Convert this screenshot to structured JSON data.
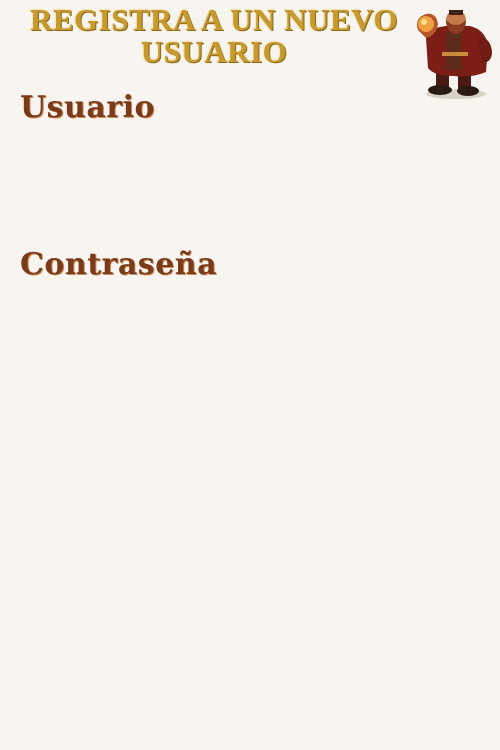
{
  "header": {
    "title": "REGISTRA A UN NUEVO USUARIO",
    "avatar_icon": "character-avatar-icon"
  },
  "form": {
    "username_label": "Usuario",
    "username_value": "",
    "password_label": "Contraseña",
    "password_value": ""
  },
  "colors": {
    "background": "#f8f5f1",
    "title": "#c89a2c",
    "label": "#7a3b1a"
  }
}
